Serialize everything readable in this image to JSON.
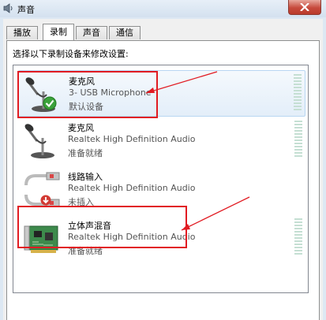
{
  "window": {
    "title": "声音"
  },
  "tabs": [
    {
      "label": "播放",
      "active": false
    },
    {
      "label": "录制",
      "active": true
    },
    {
      "label": "声音",
      "active": false
    },
    {
      "label": "通信",
      "active": false
    }
  ],
  "instruction": "选择以下录制设备来修改设置:",
  "devices": [
    {
      "name": "麦克风",
      "description": "3- USB Microphone",
      "status": "默认设备",
      "icon": "microphone-icon",
      "default": true,
      "selected": true
    },
    {
      "name": "麦克风",
      "description": "Realtek High Definition Audio",
      "status": "准备就绪",
      "icon": "microphone-icon",
      "default": false,
      "selected": false
    },
    {
      "name": "线路输入",
      "description": "Realtek High Definition Audio",
      "status": "未插入",
      "icon": "line-in-cable-icon",
      "default": false,
      "selected": false
    },
    {
      "name": "立体声混音",
      "description": "Realtek High Definition Audio",
      "status": "准备就绪",
      "icon": "sound-card-icon",
      "default": false,
      "selected": false
    }
  ],
  "colors": {
    "annotation_red": "#e11b22",
    "selection_background": "#e3eef9",
    "level_meter": "#c5dfd3"
  }
}
